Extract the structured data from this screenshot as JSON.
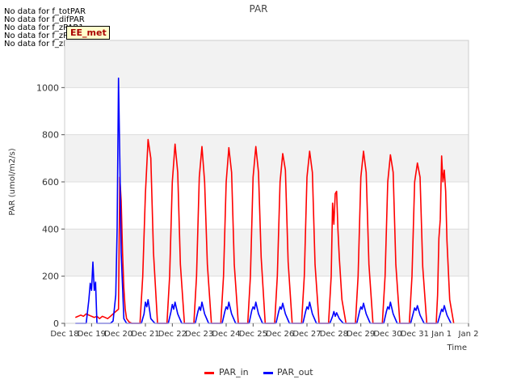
{
  "no_data_messages": [
    "No data for f_totPAR",
    "No data for f_difPAR",
    "No data for f_zPAR1",
    "No data for f_zPAR2",
    "No data for f_zPAR3"
  ],
  "tag_label": "EE_met",
  "chart_data": {
    "type": "line",
    "title": "PAR",
    "xlabel": "Time",
    "ylabel": "PAR (umol/m2/s)",
    "ylim": [
      0,
      1200
    ],
    "xlim": [
      0,
      15
    ],
    "x_tick_labels": [
      "Dec 18",
      "Dec 19",
      "Dec 20",
      "Dec 21",
      "Dec 22",
      "Dec 23",
      "Dec 24",
      "Dec 25",
      "Dec 26",
      "Dec 27",
      "Dec 28",
      "Dec 29",
      "Dec 30",
      "Dec 31",
      "Jan 1",
      "Jan 2"
    ],
    "y_ticks": [
      0,
      200,
      400,
      600,
      800,
      1000
    ],
    "grid": true,
    "legend_position": "bottom",
    "series": [
      {
        "name": "PAR_in",
        "color": "#ff0000",
        "x": [
          0.4,
          0.5,
          0.6,
          0.7,
          0.8,
          0.9,
          1.0,
          1.1,
          1.2,
          1.3,
          1.4,
          1.5,
          1.6,
          1.7,
          1.8,
          1.9,
          2.0,
          2.05,
          2.1,
          2.15,
          2.2,
          2.25,
          2.3,
          2.4,
          2.5,
          2.8,
          2.9,
          3.0,
          3.1,
          3.2,
          3.3,
          3.45,
          3.8,
          3.9,
          4.0,
          4.1,
          4.2,
          4.3,
          4.45,
          4.8,
          4.9,
          5.0,
          5.1,
          5.2,
          5.3,
          5.45,
          5.8,
          5.9,
          6.0,
          6.1,
          6.2,
          6.3,
          6.45,
          6.8,
          6.9,
          7.0,
          7.1,
          7.2,
          7.3,
          7.45,
          7.8,
          7.9,
          8.0,
          8.1,
          8.2,
          8.3,
          8.45,
          8.8,
          8.9,
          9.0,
          9.1,
          9.2,
          9.3,
          9.45,
          9.8,
          9.9,
          9.95,
          10.0,
          10.05,
          10.1,
          10.15,
          10.2,
          10.3,
          10.45,
          10.8,
          10.9,
          11.0,
          11.1,
          11.2,
          11.3,
          11.45,
          11.8,
          11.9,
          12.0,
          12.1,
          12.2,
          12.3,
          12.45,
          12.8,
          12.9,
          13.0,
          13.1,
          13.2,
          13.3,
          13.45,
          13.8,
          13.85,
          13.9,
          13.95,
          14.0,
          14.05,
          14.1,
          14.15,
          14.2,
          14.3,
          14.45
        ],
        "y": [
          25,
          30,
          35,
          30,
          40,
          35,
          30,
          25,
          30,
          20,
          30,
          25,
          20,
          30,
          40,
          50,
          60,
          620,
          520,
          300,
          150,
          60,
          20,
          5,
          0,
          0,
          200,
          550,
          780,
          700,
          300,
          0,
          0,
          200,
          600,
          760,
          640,
          250,
          0,
          0,
          200,
          620,
          750,
          600,
          250,
          0,
          0,
          200,
          600,
          745,
          640,
          250,
          0,
          0,
          200,
          620,
          750,
          640,
          280,
          0,
          0,
          200,
          600,
          720,
          650,
          260,
          0,
          0,
          200,
          620,
          730,
          640,
          250,
          0,
          0,
          200,
          510,
          420,
          550,
          560,
          400,
          280,
          100,
          0,
          0,
          200,
          620,
          730,
          640,
          250,
          0,
          0,
          200,
          600,
          715,
          640,
          250,
          0,
          0,
          200,
          600,
          680,
          620,
          240,
          0,
          0,
          120,
          360,
          440,
          710,
          600,
          650,
          560,
          350,
          100,
          0
        ]
      },
      {
        "name": "PAR_out",
        "color": "#0000ff",
        "x": [
          0.4,
          0.6,
          0.8,
          0.9,
          0.95,
          1.0,
          1.05,
          1.1,
          1.15,
          1.2,
          1.3,
          1.5,
          1.7,
          1.8,
          1.9,
          1.95,
          2.0,
          2.05,
          2.1,
          2.2,
          2.3,
          2.85,
          2.95,
          3.0,
          3.05,
          3.1,
          3.15,
          3.2,
          3.35,
          3.85,
          3.95,
          4.0,
          4.05,
          4.1,
          4.2,
          4.35,
          4.85,
          4.95,
          5.0,
          5.05,
          5.1,
          5.2,
          5.35,
          5.85,
          5.95,
          6.0,
          6.05,
          6.1,
          6.2,
          6.35,
          6.85,
          6.95,
          7.0,
          7.05,
          7.1,
          7.2,
          7.35,
          7.85,
          7.95,
          8.0,
          8.05,
          8.1,
          8.2,
          8.35,
          8.85,
          8.95,
          9.0,
          9.05,
          9.1,
          9.2,
          9.35,
          9.85,
          9.95,
          10.0,
          10.05,
          10.1,
          10.2,
          10.35,
          10.85,
          10.95,
          11.0,
          11.05,
          11.1,
          11.2,
          11.35,
          11.85,
          11.95,
          12.0,
          12.05,
          12.1,
          12.2,
          12.35,
          12.85,
          12.95,
          13.0,
          13.05,
          13.1,
          13.2,
          13.35,
          13.85,
          13.95,
          14.0,
          14.05,
          14.1,
          14.2,
          14.35
        ],
        "y": [
          0,
          0,
          0,
          100,
          170,
          140,
          260,
          140,
          175,
          0,
          0,
          0,
          0,
          10,
          120,
          400,
          1040,
          700,
          300,
          20,
          0,
          0,
          40,
          90,
          70,
          100,
          60,
          20,
          0,
          0,
          50,
          80,
          60,
          90,
          40,
          0,
          0,
          50,
          70,
          55,
          90,
          40,
          0,
          0,
          50,
          70,
          60,
          90,
          40,
          0,
          0,
          55,
          70,
          60,
          90,
          40,
          0,
          0,
          50,
          70,
          60,
          85,
          40,
          0,
          0,
          50,
          70,
          60,
          90,
          40,
          0,
          0,
          30,
          50,
          30,
          45,
          20,
          0,
          0,
          50,
          70,
          60,
          85,
          40,
          0,
          0,
          50,
          70,
          60,
          90,
          40,
          0,
          0,
          45,
          65,
          55,
          75,
          35,
          0,
          0,
          40,
          60,
          50,
          75,
          35,
          0
        ]
      }
    ]
  }
}
